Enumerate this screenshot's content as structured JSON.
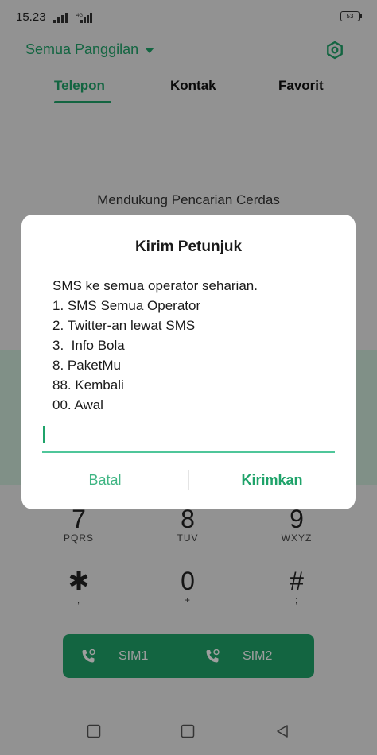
{
  "status_bar": {
    "time": "15.23",
    "network_label": "4G",
    "battery_level": "53"
  },
  "header": {
    "filter_label": "Semua Panggilan",
    "settings_icon": "gear-icon"
  },
  "tabs": [
    {
      "label": "Telepon",
      "active": true
    },
    {
      "label": "Kontak",
      "active": false
    },
    {
      "label": "Favorit",
      "active": false
    }
  ],
  "smart_search_text": "Mendukung Pencarian Cerdas",
  "dialpad": {
    "keys": [
      {
        "digit": "7",
        "letters": "PQRS"
      },
      {
        "digit": "8",
        "letters": "TUV"
      },
      {
        "digit": "9",
        "letters": "WXYZ"
      },
      {
        "digit": "✱",
        "letters": ","
      },
      {
        "digit": "0",
        "letters": "+"
      },
      {
        "digit": "#",
        "letters": ";"
      }
    ]
  },
  "call_buttons": {
    "sim1_label": "SIM1",
    "sim2_label": "SIM2"
  },
  "dialog": {
    "title": "Kirim Petunjuk",
    "message_lines": [
      "SMS ke semua operator seharian.",
      "1. SMS Semua Operator",
      "2. Twitter-an lewat SMS",
      "3.  Info Bola",
      "8. PaketMu",
      "88. Kembali",
      "00. Awal"
    ],
    "input_value": "",
    "cancel_label": "Batal",
    "send_label": "Kirimkan"
  },
  "colors": {
    "accent": "#1fa36a",
    "input_underline": "#4fc69a"
  }
}
